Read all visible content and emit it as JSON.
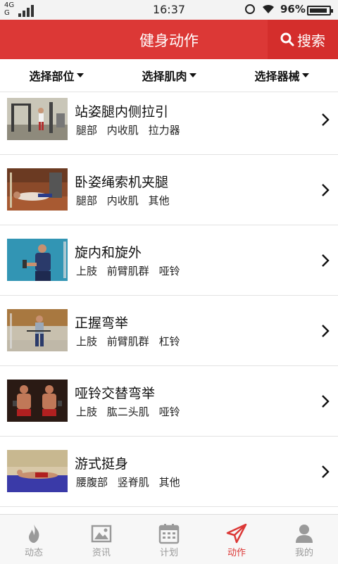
{
  "status_bar": {
    "network_top": "4G",
    "network_bottom": "G",
    "time": "16:37",
    "battery_pct": "96%"
  },
  "header": {
    "title": "健身动作",
    "search_label": "搜索"
  },
  "filters": [
    {
      "label": "选择部位"
    },
    {
      "label": "选择肌肉"
    },
    {
      "label": "选择器械"
    }
  ],
  "exercises": [
    {
      "title": "站姿腿内侧拉引",
      "tags": [
        "腿部",
        "内收肌",
        "拉力器"
      ],
      "thumb": "gym-machine"
    },
    {
      "title": "卧姿绳索机夹腿",
      "tags": [
        "腿部",
        "内收肌",
        "其他"
      ],
      "thumb": "lying-cable"
    },
    {
      "title": "旋内和旋外",
      "tags": [
        "上肢",
        "前臂肌群",
        "哑铃"
      ],
      "thumb": "blue-seated"
    },
    {
      "title": "正握弯举",
      "tags": [
        "上肢",
        "前臂肌群",
        "杠铃"
      ],
      "thumb": "standing-barbell"
    },
    {
      "title": "哑铃交替弯举",
      "tags": [
        "上肢",
        "肱二头肌",
        "哑铃"
      ],
      "thumb": "two-men-dumbbell"
    },
    {
      "title": "游式挺身",
      "tags": [
        "腰腹部",
        "竖脊肌",
        "其他"
      ],
      "thumb": "floor-swim"
    }
  ],
  "tabs": [
    {
      "label": "动态",
      "icon": "flame-icon",
      "active": false
    },
    {
      "label": "资讯",
      "icon": "image-icon",
      "active": false
    },
    {
      "label": "计划",
      "icon": "calendar-icon",
      "active": false
    },
    {
      "label": "动作",
      "icon": "paper-plane-icon",
      "active": true
    },
    {
      "label": "我的",
      "icon": "person-icon",
      "active": false
    }
  ],
  "colors": {
    "brand_red": "#dc3836",
    "tab_inactive": "#9a9a9a"
  }
}
